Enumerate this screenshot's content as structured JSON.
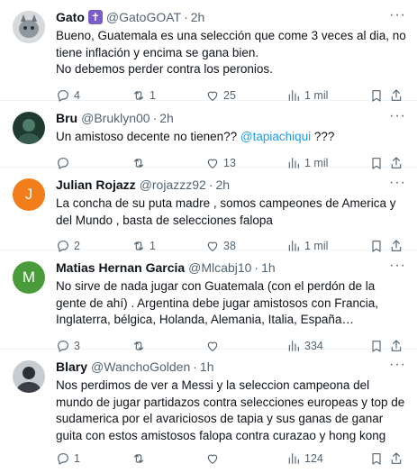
{
  "tweets": [
    {
      "name": "Gato",
      "badge": "✝",
      "handle": "@GatoGOAT",
      "time": "2h",
      "text": "Bueno, Guatemala es una selección que come 3 veces al dia, no tiene inflación y encima se gana bien.\nNo debemos perder contra los peronios.",
      "replies": "4",
      "retweets": "1",
      "likes": "25",
      "views": "1 mil",
      "avatar_color": "#9aa3ab"
    },
    {
      "name": "Bru",
      "handle": "@Bruklyn00",
      "time": "2h",
      "text_before": "Un amistoso decente no tienen?? ",
      "mention": "@tapiachiqui",
      "text_after": " ???",
      "replies": "",
      "retweets": "",
      "likes": "13",
      "views": "1 mil",
      "avatar_color": "#2c4a3e"
    },
    {
      "name": "Julian Rojazz",
      "handle": "@rojazzz92",
      "time": "2h",
      "text": "La concha de su puta madre , somos campeones de America y del Mundo , basta de selecciones falopa",
      "replies": "2",
      "retweets": "1",
      "likes": "38",
      "views": "1 mil",
      "avatar_letter": "J",
      "avatar_color": "#f27d1b"
    },
    {
      "name": "Matias Hernan Garcia",
      "handle": "@Mlcabj10",
      "time": "1h",
      "text": "No sirve de nada jugar con Guatemala (con el perdón de la gente de ahí) . Argentina debe jugar amistosos con Francia, Inglaterra, bélgica, Holanda, Alemania, Italia, España…",
      "replies": "3",
      "retweets": "",
      "likes": "",
      "views": "334",
      "avatar_letter": "M",
      "avatar_color": "#4a9c3a"
    },
    {
      "name": "Blary",
      "handle": "@WanchoGolden",
      "time": "1h",
      "text": "Nos perdimos de ver a Messi y la seleccion campeona del mundo de jugar partidazos contra selecciones europeas y top de sudamerica por el avariciosos de tapia y sus ganas de ganar guita con estos amistosos falopa contra curazao y hong kong",
      "replies": "1",
      "retweets": "",
      "likes": "",
      "views": "124",
      "avatar_color": "#3a3f44"
    }
  ]
}
